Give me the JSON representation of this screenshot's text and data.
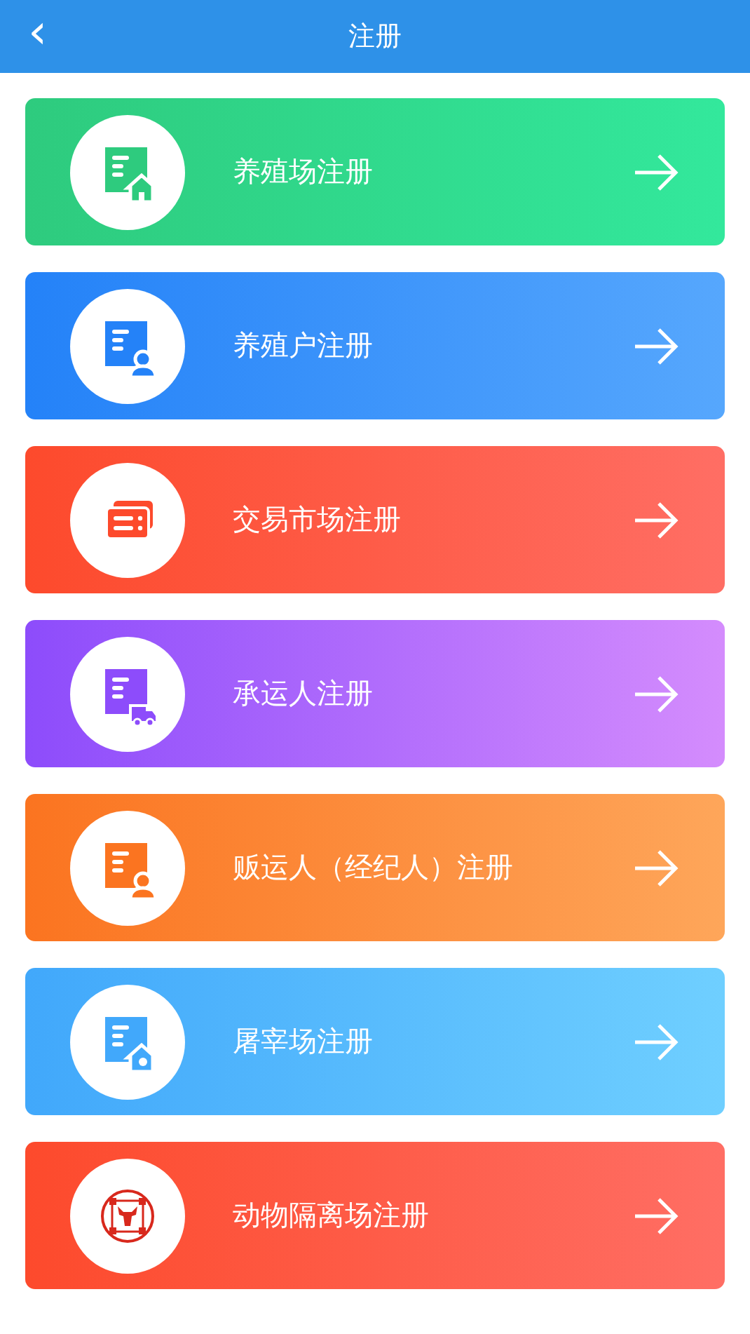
{
  "header": {
    "back": "‹",
    "title": "注册"
  },
  "cards": [
    {
      "kind": "farm",
      "label": "养殖场注册"
    },
    {
      "kind": "household",
      "label": "养殖户注册"
    },
    {
      "kind": "market",
      "label": "交易市场注册"
    },
    {
      "kind": "carrier",
      "label": "承运人注册"
    },
    {
      "kind": "broker",
      "label": "贩运人（经纪人）注册"
    },
    {
      "kind": "slaughter",
      "label": "屠宰场注册"
    },
    {
      "kind": "quarantine",
      "label": "动物隔离场注册"
    }
  ]
}
